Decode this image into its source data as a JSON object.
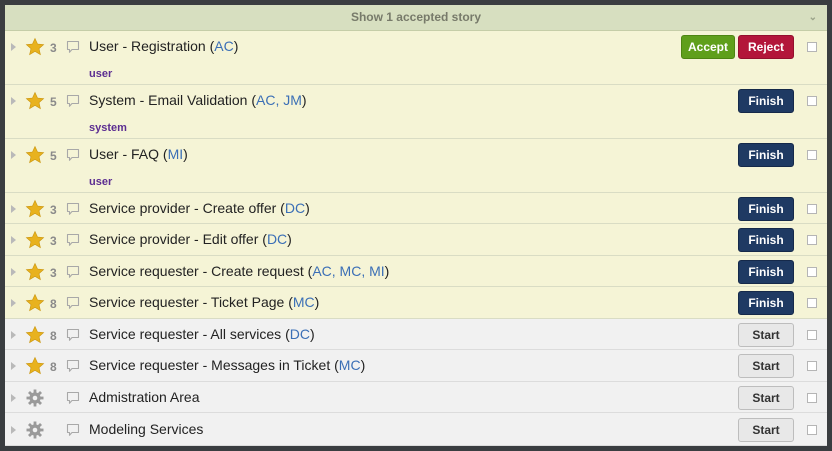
{
  "header": {
    "show_accepted_label": "Show 1 accepted story"
  },
  "stories": [
    {
      "title": "User - Registration",
      "owners": "AC",
      "estimate": "3",
      "label": "user",
      "state": "delivered",
      "actions": [
        "Accept",
        "Reject"
      ]
    },
    {
      "title": "System - Email Validation",
      "owners": "AC, JM",
      "estimate": "5",
      "label": "system",
      "state": "started",
      "actions": [
        "Finish"
      ]
    },
    {
      "title": "User - FAQ",
      "owners": "MI",
      "estimate": "5",
      "label": "user",
      "state": "started",
      "actions": [
        "Finish"
      ]
    },
    {
      "title": "Service provider - Create offer",
      "owners": "DC",
      "estimate": "3",
      "state": "started",
      "actions": [
        "Finish"
      ]
    },
    {
      "title": "Service provider - Edit offer",
      "owners": "DC",
      "estimate": "3",
      "state": "started",
      "actions": [
        "Finish"
      ]
    },
    {
      "title": "Service requester - Create request",
      "owners": "AC, MC, MI",
      "estimate": "3",
      "state": "started",
      "actions": [
        "Finish"
      ]
    },
    {
      "title": "Service requester - Ticket Page",
      "owners": "MC",
      "estimate": "8",
      "state": "started",
      "actions": [
        "Finish"
      ]
    },
    {
      "title": "Service requester - All services",
      "owners": "DC",
      "estimate": "8",
      "state": "unstarted",
      "actions": [
        "Start"
      ]
    },
    {
      "title": "Service requester - Messages in Ticket",
      "owners": "MC",
      "estimate": "8",
      "state": "unstarted",
      "actions": [
        "Start"
      ]
    },
    {
      "title": "Admistration Area",
      "type": "chore",
      "state": "unstarted",
      "actions": [
        "Start"
      ]
    },
    {
      "title": "Modeling Services",
      "type": "chore",
      "state": "unstarted",
      "actions": [
        "Start"
      ]
    }
  ],
  "icons": {
    "feature": "star-icon",
    "chore": "gear-icon",
    "comment": "comment-icon",
    "expand": "expand-arrow-icon",
    "collapse_header": "chevron-down-icon"
  },
  "colors": {
    "started_row": "#f5f4d6",
    "unstarted_row": "#f1f1f1",
    "finish_button": "#1f3a63",
    "accept_button": "#5f9f1b",
    "reject_button": "#b3163a",
    "star": "#e8b21e",
    "label_text": "#5c2d91",
    "owner_text": "#3b6fb6"
  }
}
